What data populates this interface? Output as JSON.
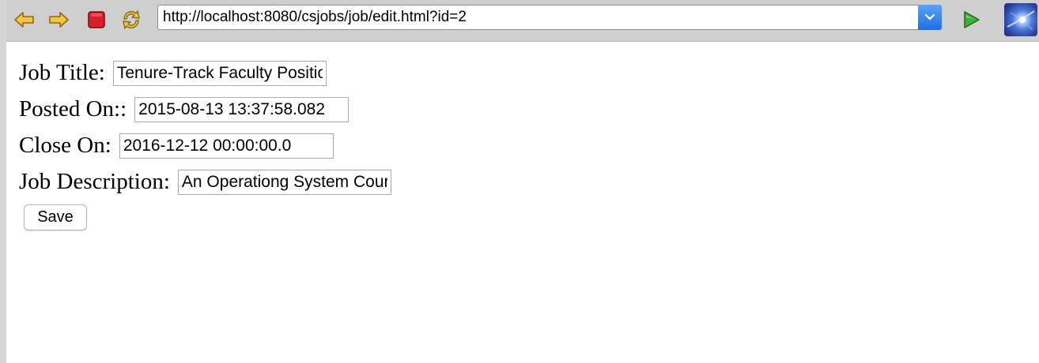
{
  "browser": {
    "url": "http://localhost:8080/csjobs/job/edit.html?id=2",
    "icons": {
      "back": "back-arrow-icon",
      "forward": "forward-arrow-icon",
      "stop": "stop-icon",
      "reload": "reload-icon",
      "dropdown": "chevron-down-icon",
      "go": "go-play-icon",
      "extension": "extension-icon"
    },
    "colors": {
      "toolbar": "#cfcfcf",
      "arrow_fill": "#f5c542",
      "stop_fill": "#d8202a",
      "go_fill": "#3fae3a",
      "dropdown_fill": "#2f80ed"
    }
  },
  "form": {
    "job_title": {
      "label": "Job Title:",
      "value": "Tenure-Track Faculty Position"
    },
    "posted_on": {
      "label": "Posted On::",
      "value": "2015-08-13 13:37:58.082"
    },
    "close_on": {
      "label": "Close On:",
      "value": "2016-12-12 00:00:00.0"
    },
    "job_description": {
      "label": "Job Description:",
      "value": "An Operationg System Course"
    },
    "save_label": "Save"
  }
}
